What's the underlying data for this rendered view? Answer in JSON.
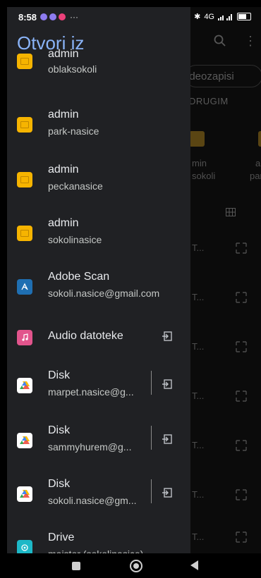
{
  "status": {
    "time": "8:58",
    "more": "···",
    "network": "4G"
  },
  "drawer": {
    "title": "Otvori iz",
    "items": [
      {
        "type": "folder",
        "title": "admin",
        "subtitle": "oblaksokoli"
      },
      {
        "type": "folder",
        "title": "admin",
        "subtitle": "park-nasice"
      },
      {
        "type": "folder",
        "title": "admin",
        "subtitle": "peckanasice"
      },
      {
        "type": "folder",
        "title": "admin",
        "subtitle": "sokolinasice"
      },
      {
        "type": "adobe",
        "title": "Adobe Scan",
        "subtitle": "sokoli.nasice@gmail.com"
      },
      {
        "type": "audio",
        "title": "Audio datoteke",
        "subtitle": ""
      },
      {
        "type": "drive",
        "title": "Disk",
        "subtitle": "marpet.nasice@g..."
      },
      {
        "type": "drive",
        "title": "Disk",
        "subtitle": "sammyhurem@g..."
      },
      {
        "type": "drive",
        "title": "Disk",
        "subtitle": "sokoli.nasice@gm..."
      },
      {
        "type": "drive2",
        "title": "Drive",
        "subtitle": "maistor (sokolinasice)"
      }
    ]
  },
  "background": {
    "chip_label": "ideozapisi",
    "section_label": "DRUGIM",
    "folder_labels": [
      {
        "line1": "min",
        "line2": "sokoli"
      },
      {
        "line1": "a",
        "line2": "park"
      }
    ],
    "row_dots": "T..."
  }
}
